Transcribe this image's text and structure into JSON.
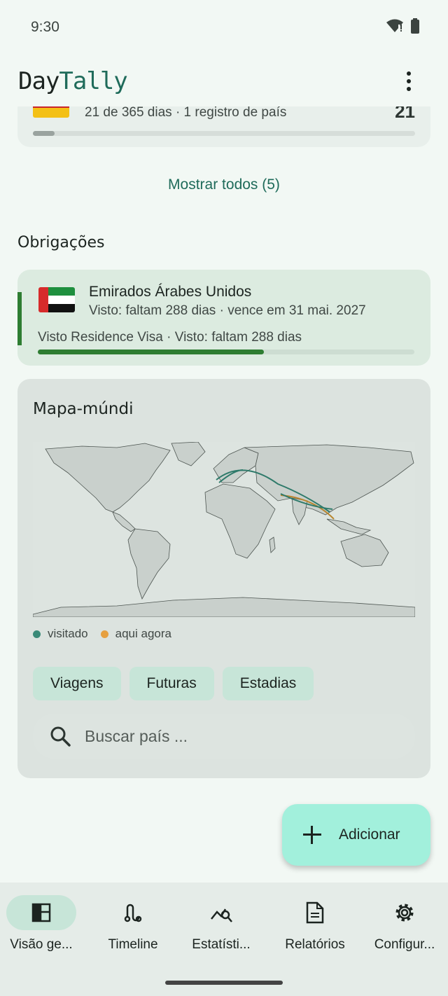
{
  "status_bar": {
    "time": "9:30"
  },
  "header": {
    "brand_part1": "Day",
    "brand_part2": "Tally"
  },
  "country_card": {
    "text": "21 de 365 dias  ·  1 registro de país",
    "count": "21",
    "progress": 0.057
  },
  "show_all": "Mostrar todos (5)",
  "obligations": {
    "title": "Obrigações",
    "items": [
      {
        "country": "Emirados Árabes Unidos",
        "subtitle": "Visto: faltam 288 dias · vence em 31 mai. 2027",
        "detail": "Visto Residence Visa · Visto: faltam 288 dias",
        "progress": 0.6
      }
    ]
  },
  "map_card": {
    "title": "Mapa-múndi",
    "legend": [
      {
        "label": "visitado",
        "color": "#3a8a78"
      },
      {
        "label": "aqui agora",
        "color": "#e6a040"
      }
    ],
    "chips": [
      "Viagens",
      "Futuras",
      "Estadias"
    ],
    "search_placeholder": "Buscar país ..."
  },
  "fab": {
    "label": "Adicionar"
  },
  "bottom_nav": {
    "items": [
      {
        "label": "Visão ge...",
        "icon": "dashboard-icon",
        "active": true
      },
      {
        "label": "Timeline",
        "icon": "route-icon",
        "active": false
      },
      {
        "label": "Estatísti...",
        "icon": "query-stats-icon",
        "active": false
      },
      {
        "label": "Relatórios",
        "icon": "document-icon",
        "active": false
      },
      {
        "label": "Configur...",
        "icon": "gear-icon",
        "active": false
      }
    ]
  },
  "colors": {
    "accent": "#1f6b5a",
    "route_visited": "#2e7a6a",
    "route_here": "#b8862f"
  }
}
